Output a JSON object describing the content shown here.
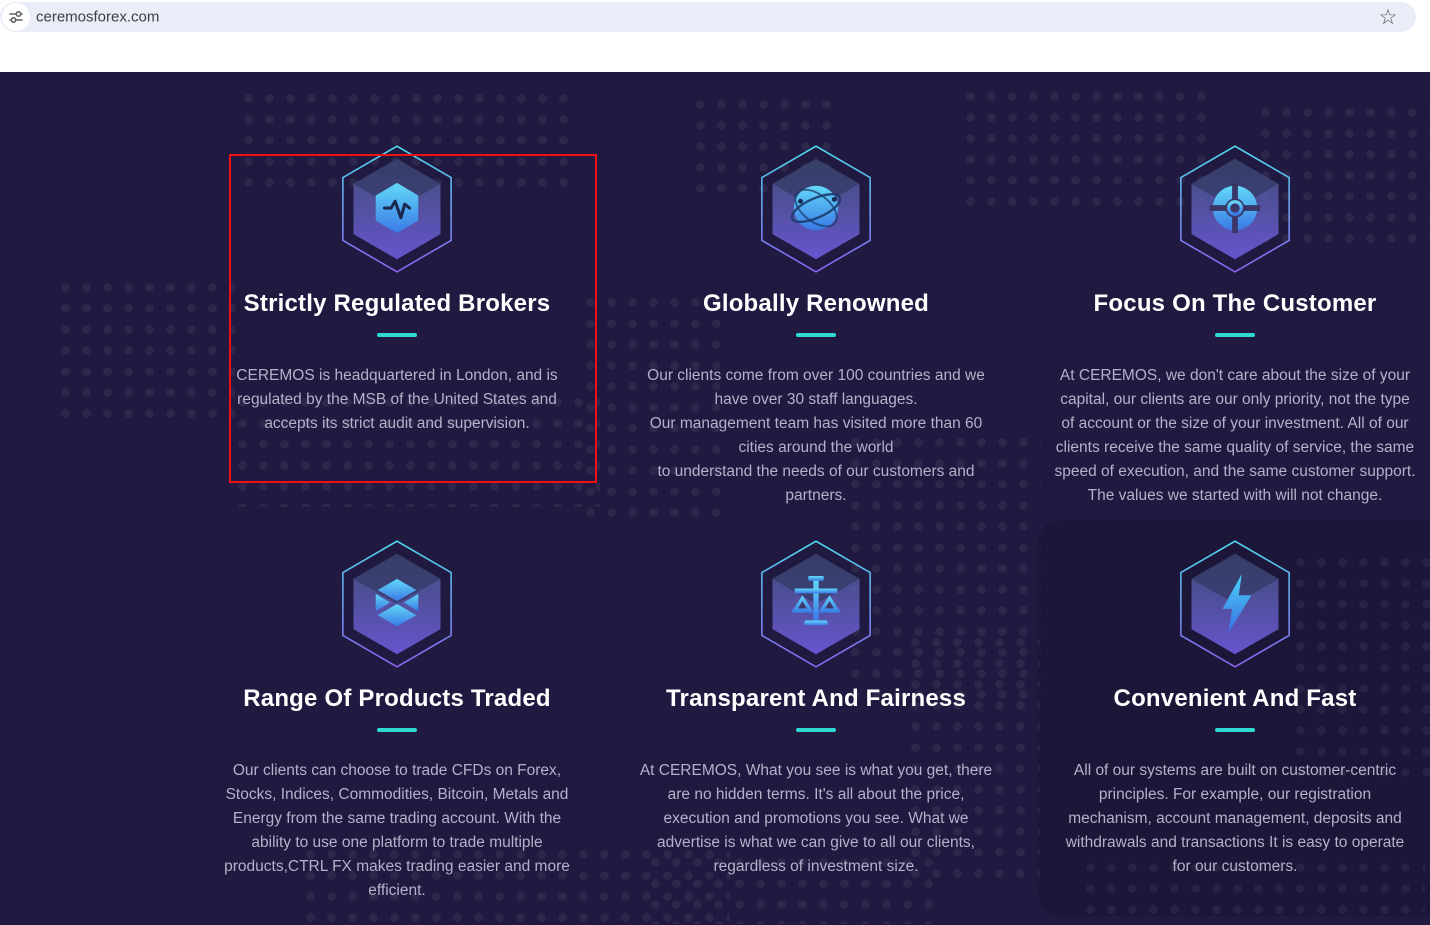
{
  "browser": {
    "url": "ceremosforex.com",
    "site_settings_icon": "site-settings-icon",
    "bookmark_star_icon": "bookmark-star-icon",
    "star_glyph": "☆"
  },
  "features": {
    "cards": [
      {
        "icon": "pulse-hexagon-icon",
        "title": "Strictly Regulated Brokers",
        "description": "CEREMOS is headquartered in London, and is regulated by the MSB of the United States and accepts its strict audit and supervision."
      },
      {
        "icon": "globe-hexagon-icon",
        "title": "Globally Renowned",
        "description": "Our clients come from over 100 countries and we have over 30 staff languages.\nOur management team has visited more than 60 cities around the world\nto understand the needs of our customers and partners."
      },
      {
        "icon": "target-hexagon-icon",
        "title": "Focus On The Customer",
        "description": "At CEREMOS, we don't care about the size of your capital, our clients are our only priority, not the type of account or the size of your investment. All of our clients receive the same quality of service, the same speed of execution, and the same customer support. The values we started with will not change."
      },
      {
        "icon": "cube-hexagon-icon",
        "title": "Range Of Products Traded",
        "description": "Our clients can choose to trade CFDs on Forex, Stocks, Indices, Commodities, Bitcoin, Metals and Energy from the same trading account. With the ability to use one platform to trade multiple products,CTRL FX makes trading easier and more efficient."
      },
      {
        "icon": "scales-hexagon-icon",
        "title": "Transparent And Fairness",
        "description": "At CEREMOS, What you see is what you get, there are no hidden terms. It's all about the price, execution and promotions you see. What we advertise is what we can give to all our clients, regardless of investment size."
      },
      {
        "icon": "lightning-hexagon-icon",
        "title": "Convenient And Fast",
        "description": "All of our systems are built on customer-centric principles. For example, our registration mechanism, account management, deposits and withdrawals and transactions It is easy to operate for our customers."
      }
    ]
  },
  "annotation": {
    "highlighted_card": "Strictly Regulated Brokers"
  },
  "colors": {
    "page_bg": "#201a41",
    "panel_bg": "#1c1639",
    "accent_teal": "#2fd8d2",
    "annotation_red": "#ee1111",
    "omnibox_bg": "#e9edf7",
    "body_text": "#b4b1c8"
  }
}
